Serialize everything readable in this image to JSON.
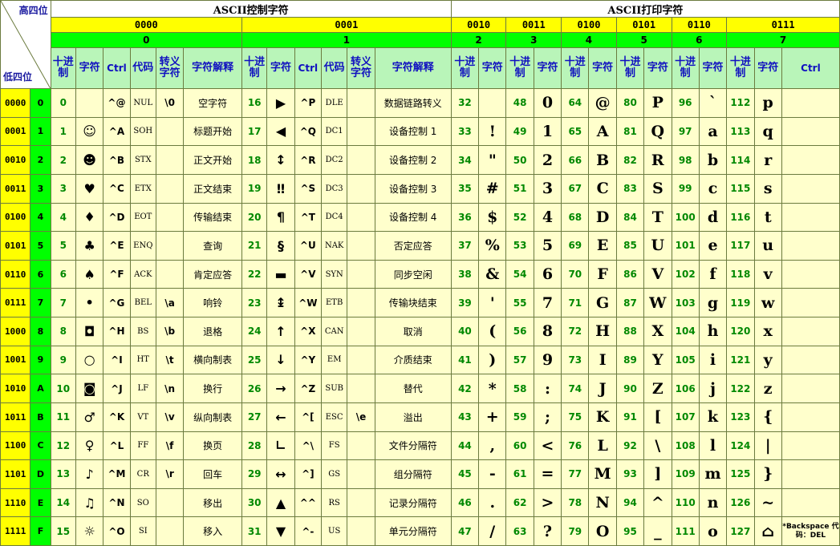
{
  "corner": {
    "high": "高四位",
    "low": "低四位"
  },
  "groups": {
    "control": "ASCII控制字符",
    "printable": "ASCII打印字符"
  },
  "high_bits": [
    "0000",
    "0001",
    "0010",
    "0011",
    "0100",
    "0101",
    "0110",
    "0111"
  ],
  "high_hex": [
    "0",
    "1",
    "2",
    "3",
    "4",
    "5",
    "6",
    "7"
  ],
  "subheaders": {
    "dec": "十进制",
    "char": "字符",
    "ctrl": "Ctrl",
    "code": "代码",
    "escape": "转义字符",
    "meaning": "字符解释"
  },
  "rows": [
    {
      "bin": "0000",
      "hex": "0",
      "c0": {
        "dec": "0",
        "char": "",
        "ctrl": "^@",
        "code": "NUL",
        "esc": "\\0",
        "desc": "空字符"
      },
      "c1": {
        "dec": "16",
        "char": "▶",
        "ctrl": "^P",
        "code": "DLE",
        "esc": "",
        "desc": "数据链路转义"
      },
      "p2": {
        "dec": "32",
        "char": ""
      },
      "p3": {
        "dec": "48",
        "char": "0"
      },
      "p4": {
        "dec": "64",
        "char": "@"
      },
      "p5": {
        "dec": "80",
        "char": "P"
      },
      "p6": {
        "dec": "96",
        "char": "`"
      },
      "p7": {
        "dec": "112",
        "char": "p",
        "ctrl": ""
      }
    },
    {
      "bin": "0001",
      "hex": "1",
      "c0": {
        "dec": "1",
        "char": "☺",
        "ctrl": "^A",
        "code": "SOH",
        "esc": "",
        "desc": "标题开始"
      },
      "c1": {
        "dec": "17",
        "char": "◀",
        "ctrl": "^Q",
        "code": "DC1",
        "esc": "",
        "desc": "设备控制 1"
      },
      "p2": {
        "dec": "33",
        "char": "!"
      },
      "p3": {
        "dec": "49",
        "char": "1"
      },
      "p4": {
        "dec": "65",
        "char": "A"
      },
      "p5": {
        "dec": "81",
        "char": "Q"
      },
      "p6": {
        "dec": "97",
        "char": "a"
      },
      "p7": {
        "dec": "113",
        "char": "q",
        "ctrl": ""
      }
    },
    {
      "bin": "0010",
      "hex": "2",
      "c0": {
        "dec": "2",
        "char": "☻",
        "ctrl": "^B",
        "code": "STX",
        "esc": "",
        "desc": "正文开始"
      },
      "c1": {
        "dec": "18",
        "char": "↕",
        "ctrl": "^R",
        "code": "DC2",
        "esc": "",
        "desc": "设备控制 2"
      },
      "p2": {
        "dec": "34",
        "char": "\""
      },
      "p3": {
        "dec": "50",
        "char": "2"
      },
      "p4": {
        "dec": "66",
        "char": "B"
      },
      "p5": {
        "dec": "82",
        "char": "R"
      },
      "p6": {
        "dec": "98",
        "char": "b"
      },
      "p7": {
        "dec": "114",
        "char": "r",
        "ctrl": ""
      }
    },
    {
      "bin": "0011",
      "hex": "3",
      "c0": {
        "dec": "3",
        "char": "♥",
        "ctrl": "^C",
        "code": "ETX",
        "esc": "",
        "desc": "正文结束"
      },
      "c1": {
        "dec": "19",
        "char": "‼",
        "ctrl": "^S",
        "code": "DC3",
        "esc": "",
        "desc": "设备控制 3"
      },
      "p2": {
        "dec": "35",
        "char": "#"
      },
      "p3": {
        "dec": "51",
        "char": "3"
      },
      "p4": {
        "dec": "67",
        "char": "C"
      },
      "p5": {
        "dec": "83",
        "char": "S"
      },
      "p6": {
        "dec": "99",
        "char": "c"
      },
      "p7": {
        "dec": "115",
        "char": "s",
        "ctrl": ""
      }
    },
    {
      "bin": "0100",
      "hex": "4",
      "c0": {
        "dec": "4",
        "char": "♦",
        "ctrl": "^D",
        "code": "EOT",
        "esc": "",
        "desc": "传输结束"
      },
      "c1": {
        "dec": "20",
        "char": "¶",
        "ctrl": "^T",
        "code": "DC4",
        "esc": "",
        "desc": "设备控制 4"
      },
      "p2": {
        "dec": "36",
        "char": "$"
      },
      "p3": {
        "dec": "52",
        "char": "4"
      },
      "p4": {
        "dec": "68",
        "char": "D"
      },
      "p5": {
        "dec": "84",
        "char": "T"
      },
      "p6": {
        "dec": "100",
        "char": "d"
      },
      "p7": {
        "dec": "116",
        "char": "t",
        "ctrl": ""
      }
    },
    {
      "bin": "0101",
      "hex": "5",
      "c0": {
        "dec": "5",
        "char": "♣",
        "ctrl": "^E",
        "code": "ENQ",
        "esc": "",
        "desc": "查询"
      },
      "c1": {
        "dec": "21",
        "char": "§",
        "ctrl": "^U",
        "code": "NAK",
        "esc": "",
        "desc": "否定应答"
      },
      "p2": {
        "dec": "37",
        "char": "%"
      },
      "p3": {
        "dec": "53",
        "char": "5"
      },
      "p4": {
        "dec": "69",
        "char": "E"
      },
      "p5": {
        "dec": "85",
        "char": "U"
      },
      "p6": {
        "dec": "101",
        "char": "e"
      },
      "p7": {
        "dec": "117",
        "char": "u",
        "ctrl": ""
      }
    },
    {
      "bin": "0110",
      "hex": "6",
      "c0": {
        "dec": "6",
        "char": "♠",
        "ctrl": "^F",
        "code": "ACK",
        "esc": "",
        "desc": "肯定应答"
      },
      "c1": {
        "dec": "22",
        "char": "▬",
        "ctrl": "^V",
        "code": "SYN",
        "esc": "",
        "desc": "同步空闲"
      },
      "p2": {
        "dec": "38",
        "char": "&"
      },
      "p3": {
        "dec": "54",
        "char": "6"
      },
      "p4": {
        "dec": "70",
        "char": "F"
      },
      "p5": {
        "dec": "86",
        "char": "V"
      },
      "p6": {
        "dec": "102",
        "char": "f"
      },
      "p7": {
        "dec": "118",
        "char": "v",
        "ctrl": ""
      }
    },
    {
      "bin": "0111",
      "hex": "7",
      "c0": {
        "dec": "7",
        "char": "•",
        "ctrl": "^G",
        "code": "BEL",
        "esc": "\\a",
        "desc": "响铃"
      },
      "c1": {
        "dec": "23",
        "char": "↨",
        "ctrl": "^W",
        "code": "ETB",
        "esc": "",
        "desc": "传输块结束"
      },
      "p2": {
        "dec": "39",
        "char": "'"
      },
      "p3": {
        "dec": "55",
        "char": "7"
      },
      "p4": {
        "dec": "71",
        "char": "G"
      },
      "p5": {
        "dec": "87",
        "char": "W"
      },
      "p6": {
        "dec": "103",
        "char": "g"
      },
      "p7": {
        "dec": "119",
        "char": "w",
        "ctrl": ""
      }
    },
    {
      "bin": "1000",
      "hex": "8",
      "c0": {
        "dec": "8",
        "char": "◘",
        "ctrl": "^H",
        "code": "BS",
        "esc": "\\b",
        "desc": "退格"
      },
      "c1": {
        "dec": "24",
        "char": "↑",
        "ctrl": "^X",
        "code": "CAN",
        "esc": "",
        "desc": "取消"
      },
      "p2": {
        "dec": "40",
        "char": "("
      },
      "p3": {
        "dec": "56",
        "char": "8"
      },
      "p4": {
        "dec": "72",
        "char": "H"
      },
      "p5": {
        "dec": "88",
        "char": "X"
      },
      "p6": {
        "dec": "104",
        "char": "h"
      },
      "p7": {
        "dec": "120",
        "char": "x",
        "ctrl": ""
      }
    },
    {
      "bin": "1001",
      "hex": "9",
      "c0": {
        "dec": "9",
        "char": "○",
        "ctrl": "^I",
        "code": "HT",
        "esc": "\\t",
        "desc": "横向制表"
      },
      "c1": {
        "dec": "25",
        "char": "↓",
        "ctrl": "^Y",
        "code": "EM",
        "esc": "",
        "desc": "介质结束"
      },
      "p2": {
        "dec": "41",
        "char": ")"
      },
      "p3": {
        "dec": "57",
        "char": "9"
      },
      "p4": {
        "dec": "73",
        "char": "I"
      },
      "p5": {
        "dec": "89",
        "char": "Y"
      },
      "p6": {
        "dec": "105",
        "char": "i"
      },
      "p7": {
        "dec": "121",
        "char": "y",
        "ctrl": ""
      }
    },
    {
      "bin": "1010",
      "hex": "A",
      "c0": {
        "dec": "10",
        "char": "◙",
        "ctrl": "^J",
        "code": "LF",
        "esc": "\\n",
        "desc": "换行"
      },
      "c1": {
        "dec": "26",
        "char": "→",
        "ctrl": "^Z",
        "code": "SUB",
        "esc": "",
        "desc": "替代"
      },
      "p2": {
        "dec": "42",
        "char": "*"
      },
      "p3": {
        "dec": "58",
        "char": ":"
      },
      "p4": {
        "dec": "74",
        "char": "J"
      },
      "p5": {
        "dec": "90",
        "char": "Z"
      },
      "p6": {
        "dec": "106",
        "char": "j"
      },
      "p7": {
        "dec": "122",
        "char": "z",
        "ctrl": ""
      }
    },
    {
      "bin": "1011",
      "hex": "B",
      "c0": {
        "dec": "11",
        "char": "♂",
        "ctrl": "^K",
        "code": "VT",
        "esc": "\\v",
        "desc": "纵向制表"
      },
      "c1": {
        "dec": "27",
        "char": "←",
        "ctrl": "^[",
        "code": "ESC",
        "esc": "\\e",
        "desc": "溢出"
      },
      "p2": {
        "dec": "43",
        "char": "+"
      },
      "p3": {
        "dec": "59",
        "char": ";"
      },
      "p4": {
        "dec": "75",
        "char": "K"
      },
      "p5": {
        "dec": "91",
        "char": "["
      },
      "p6": {
        "dec": "107",
        "char": "k"
      },
      "p7": {
        "dec": "123",
        "char": "{",
        "ctrl": ""
      }
    },
    {
      "bin": "1100",
      "hex": "C",
      "c0": {
        "dec": "12",
        "char": "♀",
        "ctrl": "^L",
        "code": "FF",
        "esc": "\\f",
        "desc": "换页"
      },
      "c1": {
        "dec": "28",
        "char": "∟",
        "ctrl": "^\\",
        "code": "FS",
        "esc": "",
        "desc": "文件分隔符"
      },
      "p2": {
        "dec": "44",
        "char": ","
      },
      "p3": {
        "dec": "60",
        "char": "<"
      },
      "p4": {
        "dec": "76",
        "char": "L"
      },
      "p5": {
        "dec": "92",
        "char": "\\"
      },
      "p6": {
        "dec": "108",
        "char": "l"
      },
      "p7": {
        "dec": "124",
        "char": "|",
        "ctrl": ""
      }
    },
    {
      "bin": "1101",
      "hex": "D",
      "c0": {
        "dec": "13",
        "char": "♪",
        "ctrl": "^M",
        "code": "CR",
        "esc": "\\r",
        "desc": "回车"
      },
      "c1": {
        "dec": "29",
        "char": "↔",
        "ctrl": "^]",
        "code": "GS",
        "esc": "",
        "desc": "组分隔符"
      },
      "p2": {
        "dec": "45",
        "char": "-"
      },
      "p3": {
        "dec": "61",
        "char": "="
      },
      "p4": {
        "dec": "77",
        "char": "M"
      },
      "p5": {
        "dec": "93",
        "char": "]"
      },
      "p6": {
        "dec": "109",
        "char": "m"
      },
      "p7": {
        "dec": "125",
        "char": "}",
        "ctrl": ""
      }
    },
    {
      "bin": "1110",
      "hex": "E",
      "c0": {
        "dec": "14",
        "char": "♫",
        "ctrl": "^N",
        "code": "SO",
        "esc": "",
        "desc": "移出"
      },
      "c1": {
        "dec": "30",
        "char": "▲",
        "ctrl": "^^",
        "code": "RS",
        "esc": "",
        "desc": "记录分隔符"
      },
      "p2": {
        "dec": "46",
        "char": "."
      },
      "p3": {
        "dec": "62",
        "char": ">"
      },
      "p4": {
        "dec": "78",
        "char": "N"
      },
      "p5": {
        "dec": "94",
        "char": "^"
      },
      "p6": {
        "dec": "110",
        "char": "n"
      },
      "p7": {
        "dec": "126",
        "char": "~",
        "ctrl": ""
      }
    },
    {
      "bin": "1111",
      "hex": "F",
      "c0": {
        "dec": "15",
        "char": "☼",
        "ctrl": "^O",
        "code": "SI",
        "esc": "",
        "desc": "移入"
      },
      "c1": {
        "dec": "31",
        "char": "▼",
        "ctrl": "^-",
        "code": "US",
        "esc": "",
        "desc": "单元分隔符"
      },
      "p2": {
        "dec": "47",
        "char": "/"
      },
      "p3": {
        "dec": "63",
        "char": "?"
      },
      "p4": {
        "dec": "79",
        "char": "O"
      },
      "p5": {
        "dec": "95",
        "char": "_"
      },
      "p6": {
        "dec": "111",
        "char": "o"
      },
      "p7": {
        "dec": "127",
        "char": "⌂",
        "ctrl": "*Backspace 代码：DEL"
      }
    }
  ]
}
